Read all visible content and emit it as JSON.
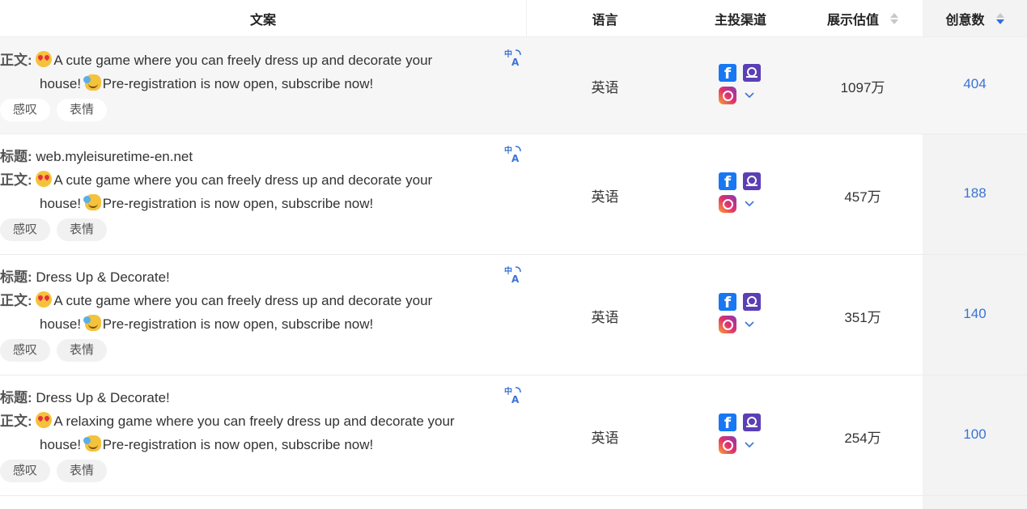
{
  "header": {
    "copy": "文案",
    "language": "语言",
    "channel": "主投渠道",
    "views": "展示估值",
    "creatives": "创意数"
  },
  "labels": {
    "title": "标题:",
    "body": "正文:"
  },
  "tags": [
    "感叹",
    "表情"
  ],
  "icons": {
    "translate": "translate-icon",
    "facebook": "facebook-icon",
    "messenger": "messenger-icon",
    "instagram": "instagram-icon",
    "expand": "chevron-down-icon"
  },
  "colors": {
    "link": "#3a73d6",
    "sort_active": "#2f6ee0",
    "facebook": "#1877f2"
  },
  "rows": [
    {
      "title": "",
      "body_line1": "A cute game where you can freely dress up and decorate your",
      "body_line2": "house! ",
      "body_line2b": "Pre-registration is now open, subscribe now!",
      "language": "英语",
      "views": "1097万",
      "count": "404"
    },
    {
      "title": "web.myleisuretime-en.net",
      "body_line1": "A cute game where you can freely dress up and decorate your",
      "body_line2": "house! ",
      "body_line2b": "Pre-registration is now open, subscribe now!",
      "language": "英语",
      "views": "457万",
      "count": "188"
    },
    {
      "title": "Dress Up & Decorate!",
      "body_line1": "A cute game where you can freely dress up and decorate your",
      "body_line2": "house! ",
      "body_line2b": "Pre-registration is now open, subscribe now!",
      "language": "英语",
      "views": "351万",
      "count": "140"
    },
    {
      "title": "Dress Up & Decorate!",
      "body_line1": "A relaxing game where you can freely dress up and decorate your",
      "body_line2": "house! ",
      "body_line2b": "Pre-registration is now open, subscribe now!",
      "language": "英语",
      "views": "254万",
      "count": "100"
    }
  ]
}
